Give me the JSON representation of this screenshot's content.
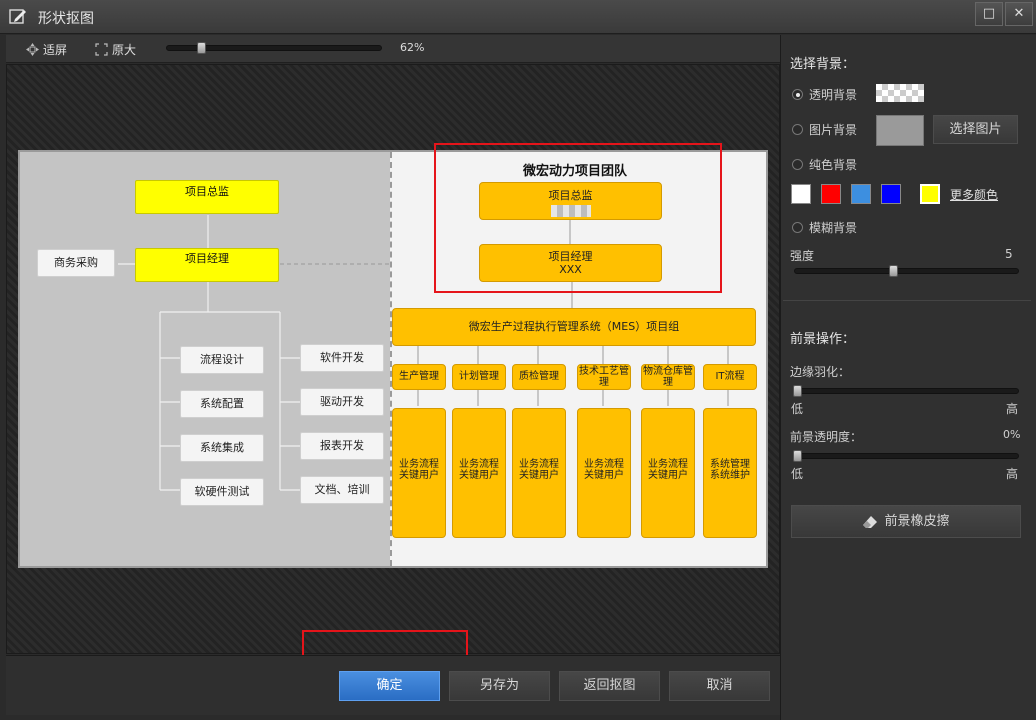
{
  "window": {
    "title": "形状抠图",
    "maximize_glyph": "□",
    "close_glyph": "✕"
  },
  "toolbar": {
    "fit_label": "适屏",
    "actual_label": "原大",
    "zoom": {
      "value": 0.62,
      "label": "62%"
    }
  },
  "preview": {
    "left": {
      "top_box": "项目总监",
      "manager_box": "项目经理",
      "purchase_box": "商务采购",
      "left_items": [
        "流程设计",
        "系统配置",
        "系统集成",
        "软硬件测试"
      ],
      "right_items": [
        "软件开发",
        "驱动开发",
        "报表开发",
        "文档、培训"
      ]
    },
    "right": {
      "team_title": "微宏动力项目团队",
      "director": "项目总监",
      "manager": "项目经理",
      "manager_name": "XXX",
      "mes_group": "微宏生产过程执行管理系统（MES）项目组",
      "modules": [
        "生产管理",
        "计划管理",
        "质检管理",
        "技术工艺管理",
        "物流仓库管理",
        "IT流程"
      ],
      "users": [
        "业务流程关键用户",
        "业务流程关键用户",
        "业务流程关键用户",
        "业务流程关键用户",
        "业务流程关键用户",
        "系统管理系统维护"
      ]
    }
  },
  "background": {
    "section_label": "选择背景：",
    "transparent_label": "透明背景",
    "image_label": "图片背景",
    "choose_image_button": "选择图片",
    "solid_label": "纯色背景",
    "colors": [
      "#ffffff",
      "#ff0000",
      "#3d8fe0",
      "#0000ff",
      "#ffff00"
    ],
    "more_colors_link": "更多颜色",
    "blur_label": "模糊背景",
    "strength_label": "强度",
    "strength": {
      "value": 5,
      "label": "5"
    },
    "selected": "transparent"
  },
  "foreground": {
    "section_label": "前景操作：",
    "feather_label": "边缘羽化：",
    "feather_low": "低",
    "feather_high": "高",
    "feather_value": 0,
    "opacity_label": "前景透明度：",
    "opacity": {
      "value": 0,
      "label": "0%"
    },
    "opacity_low": "低",
    "opacity_high": "高",
    "eraser_button": "前景橡皮擦"
  },
  "actions": {
    "confirm": "确定",
    "save_as": "另存为",
    "back": "返回抠图",
    "cancel": "取消"
  }
}
